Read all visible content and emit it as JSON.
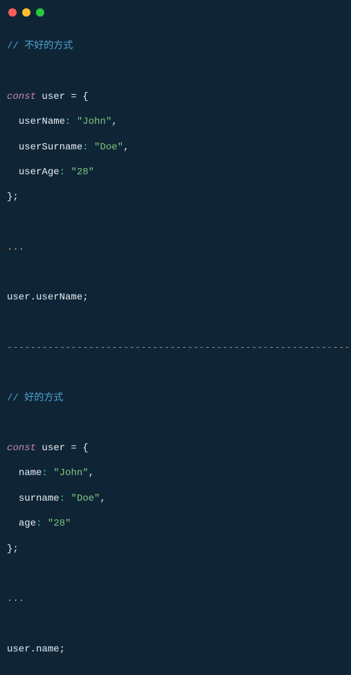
{
  "titlebar": {
    "dots": [
      "red",
      "yellow",
      "green"
    ]
  },
  "bad": {
    "comment": "// 不好的方式",
    "decl_keyword": "const",
    "decl_name": "user",
    "decl_open": " = {",
    "props": [
      {
        "key": "userName",
        "value": "\"John\"",
        "comma": ","
      },
      {
        "key": "userSurname",
        "value": "\"Doe\"",
        "comma": ","
      },
      {
        "key": "userAge",
        "value": "\"28\"",
        "comma": ""
      }
    ],
    "decl_close": "};",
    "ellipsis": "...",
    "usage_obj": "user",
    "usage_dot": ".",
    "usage_prop": "userName",
    "usage_semi": ";"
  },
  "divider": "-----------------------------------------------------------",
  "good": {
    "comment": "// 好的方式",
    "decl_keyword": "const",
    "decl_name": "user",
    "decl_open": " = {",
    "props": [
      {
        "key": "name",
        "value": "\"John\"",
        "comma": ","
      },
      {
        "key": "surname",
        "value": "\"Doe\"",
        "comma": ","
      },
      {
        "key": "age",
        "value": "\"28\"",
        "comma": ""
      }
    ],
    "decl_close": "};",
    "ellipsis": "...",
    "usage_obj": "user",
    "usage_dot": ".",
    "usage_prop": "name",
    "usage_semi": ";"
  }
}
